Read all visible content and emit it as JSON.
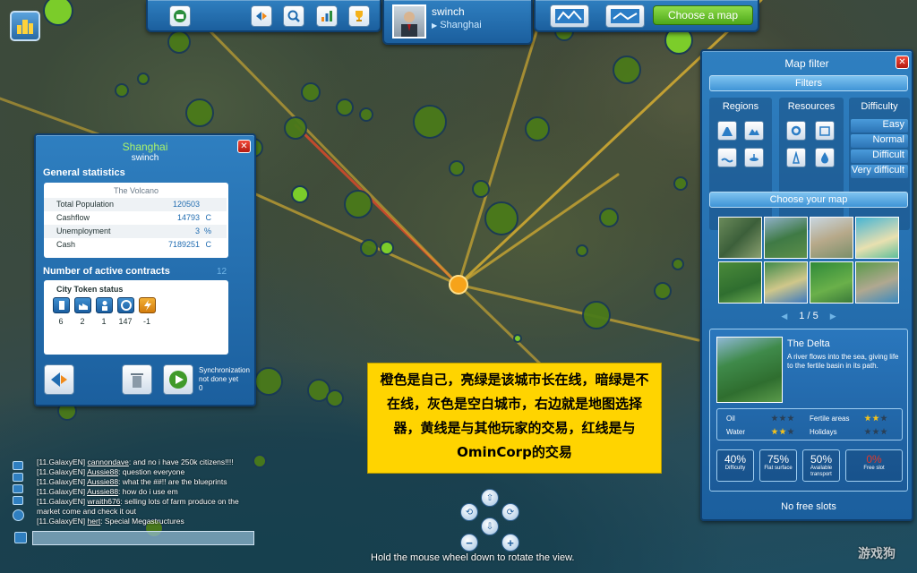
{
  "topbar": {
    "player_name": "swinch",
    "player_city": "Shanghai",
    "choose_map_label": "Choose a map"
  },
  "city_panel": {
    "title": "Shanghai",
    "owner": "swinch",
    "general_stats_heading": "General statistics",
    "region_name": "The Volcano",
    "stats": [
      {
        "label": "Total Population",
        "value": "120503",
        "unit": ""
      },
      {
        "label": "Cashflow",
        "value": "14793",
        "unit": "C"
      },
      {
        "label": "Unemployment",
        "value": "3",
        "unit": "%"
      },
      {
        "label": "Cash",
        "value": "7189251",
        "unit": "C"
      }
    ],
    "contracts_heading": "Number of active contracts",
    "contracts_count": "12",
    "token_heading": "City Token status",
    "tokens": [
      {
        "icon": "building-icon",
        "value": "6"
      },
      {
        "icon": "factory-icon",
        "value": "2"
      },
      {
        "icon": "worker-icon",
        "value": "1"
      },
      {
        "icon": "credit-icon",
        "value": "147"
      },
      {
        "icon": "energy-icon",
        "value": "-1"
      }
    ],
    "sync_label": "Synchronization",
    "sync_status": "not done yet",
    "sync_count": "0"
  },
  "map_filter": {
    "title": "Map filter",
    "filters_label": "Filters",
    "regions_label": "Regions",
    "resources_label": "Resources",
    "difficulty_label": "Difficulty",
    "difficulty_options": [
      "Easy",
      "Normal",
      "Difficult",
      "Very difficult"
    ],
    "choose_map_label": "Choose your map",
    "pager": "1 / 5",
    "selected_map": {
      "name": "The Delta",
      "description": "A river flows into the sea, giving life to the fertile basin in its path."
    },
    "ratings": [
      {
        "label": "Oil",
        "stars": 0
      },
      {
        "label": "Fertile areas",
        "stars": 2
      },
      {
        "label": "Water",
        "stars": 2
      },
      {
        "label": "Holidays",
        "stars": 0
      }
    ],
    "tiles": [
      {
        "big": "40%",
        "small": "Difficulty"
      },
      {
        "big": "75%",
        "small": "Flat surface"
      },
      {
        "big": "50%",
        "small": "Available transport"
      },
      {
        "big": "0%",
        "small": "Free slot"
      }
    ],
    "no_free_slots": "No free slots",
    "colors": {
      "accent_green": "#4ea81a",
      "star_on": "#f4c21b",
      "close_red": "#d42a1a"
    }
  },
  "note": {
    "text": "橙色是自己，亮绿是该城市长在线，暗绿是不在线，灰色是空白城市，右边就是地图选择器，黄线是与其他玩家的交易，红线是与OminCorp的交易"
  },
  "chat": [
    {
      "prefix": "[11.GalaxyEN] ",
      "user": "cannondave",
      "msg": ": and no i have 250k citizens!!!!"
    },
    {
      "prefix": "[11.GalaxyEN] ",
      "user": "Aussie88",
      "msg": ": question everyone"
    },
    {
      "prefix": "[11.GalaxyEN] ",
      "user": "Aussie88",
      "msg": ": what the ##!! are the blueprints"
    },
    {
      "prefix": "[11.GalaxyEN] ",
      "user": "Aussie88",
      "msg": ": how do i use em"
    },
    {
      "prefix": "[11.GalaxyEN] ",
      "user": "wraith676",
      "msg": ": selling lots of farm produce on the"
    },
    {
      "prefix": "",
      "user": "",
      "msg": "market come and check it out"
    },
    {
      "prefix": "[11.GalaxyEN] ",
      "user": "hert",
      "msg": ": Special Megastructures"
    }
  ],
  "hint": "Hold the mouse wheel down to rotate the view.",
  "watermark": "游戏狗"
}
